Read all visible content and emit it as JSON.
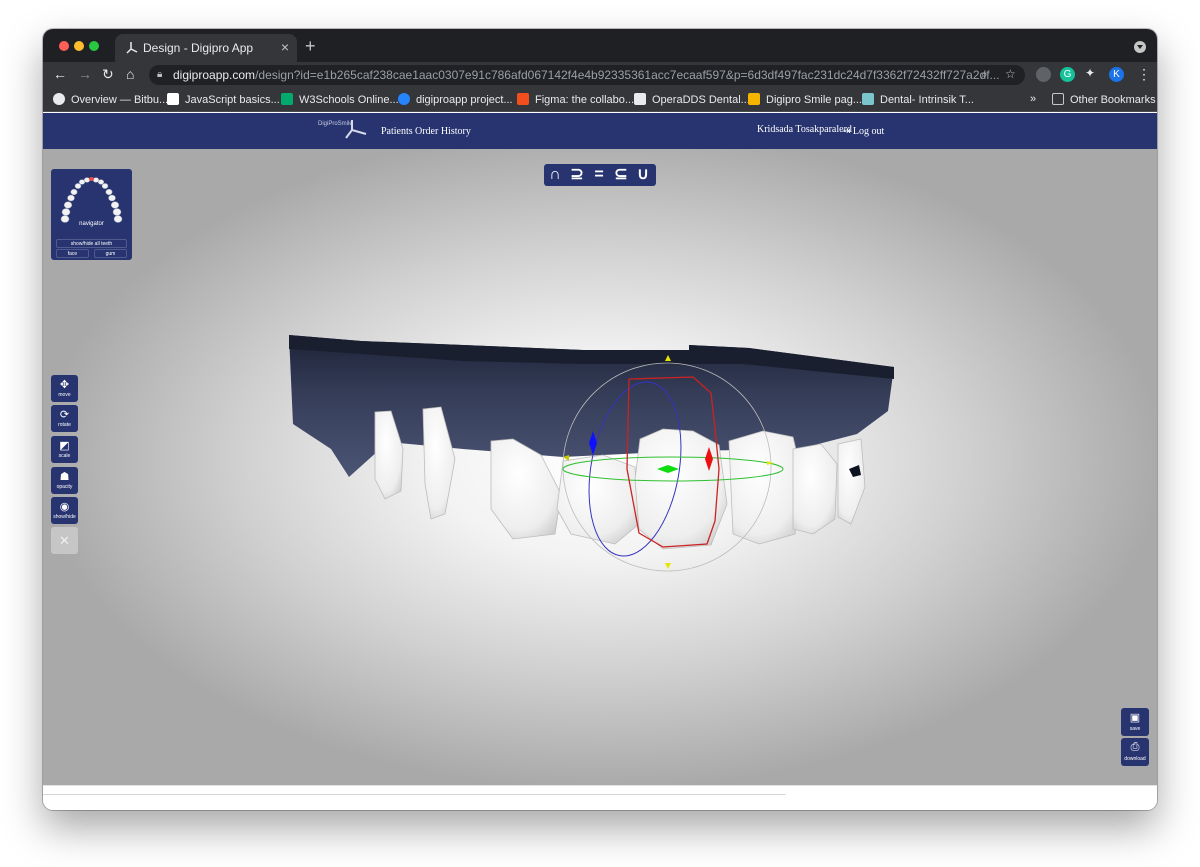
{
  "browser": {
    "tab_title": "Design - Digipro App",
    "new_tab_glyph": "+",
    "close_glyph": "×",
    "url_host": "digiproapp.com",
    "url_path": "/design?id=e1b265caf238cae1aac0307e91c786afd067142f4e4b92335361acc7ecaaf597&p=6d3df497fac231dc24d7f3362f72432ff727a2df...",
    "profile_initial": "K",
    "grammarly_initial": "G"
  },
  "bookmarks": {
    "items": [
      {
        "label": "Overview — Bitbu...",
        "icon": "globe-icon",
        "color": "#e8eaed"
      },
      {
        "label": "JavaScript basics...",
        "icon": "mdn-icon",
        "color": "#ffffff"
      },
      {
        "label": "W3Schools Online...",
        "icon": "w3schools-icon",
        "color": "#04aa6d"
      },
      {
        "label": "digiproapp project...",
        "icon": "jira-icon",
        "color": "#2684ff"
      },
      {
        "label": "Figma: the collabo...",
        "icon": "figma-icon",
        "color": "#f24e1e"
      },
      {
        "label": "OperaDDS Dental...",
        "icon": "document-icon",
        "color": "#e8eaed"
      },
      {
        "label": "Digipro Smile pag...",
        "icon": "slides-icon",
        "color": "#f4b400"
      },
      {
        "label": "Dental- Intrinsik T...",
        "icon": "image-icon",
        "color": "#7bc6cc"
      }
    ],
    "overflow": "»",
    "other": "Other Bookmarks"
  },
  "app": {
    "logo_text": "DigiProSmile",
    "nav": {
      "patients": "Patients",
      "order_history": "Order History"
    },
    "user_name": "Kridsada Tosakparalerd",
    "logout": "Log out",
    "brand_color": "#273470"
  },
  "navigator": {
    "label": "navigator",
    "show_hide_all": "show/hide all teeth",
    "face": "face",
    "gum": "gum"
  },
  "view_tools": [
    "∩",
    "⊇",
    "=",
    "⊆",
    "∪"
  ],
  "tools": [
    {
      "label": "move",
      "icon": "move-icon",
      "glyph": "✥"
    },
    {
      "label": "rotate",
      "icon": "rotate-icon",
      "glyph": "⟳"
    },
    {
      "label": "scale",
      "icon": "scale-icon",
      "glyph": "◩"
    },
    {
      "label": "opacity",
      "icon": "ghost-icon",
      "glyph": "☗"
    },
    {
      "label": "show/hide",
      "icon": "eye-icon",
      "glyph": "◉"
    },
    {
      "label": "",
      "icon": "close-icon",
      "glyph": "✕"
    }
  ],
  "actions": {
    "save": {
      "label": "save",
      "glyph": "▣"
    },
    "download": {
      "label": "download",
      "glyph": "⎙"
    }
  }
}
